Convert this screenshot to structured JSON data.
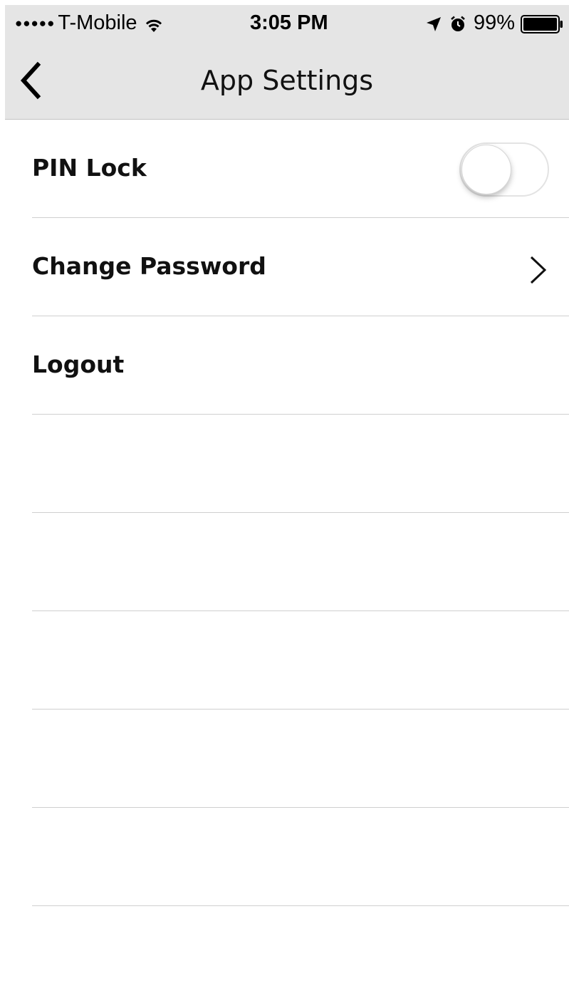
{
  "status_bar": {
    "signal_dots": "●●●●●",
    "carrier": "T-Mobile",
    "time": "3:05 PM",
    "battery_percent": "99%",
    "icons": [
      "wifi-icon",
      "location-arrow-icon",
      "alarm-clock-icon",
      "battery-icon"
    ]
  },
  "nav": {
    "title": "App Settings",
    "back_icon": "chevron-left-icon"
  },
  "settings": {
    "pin_lock": {
      "label": "PIN Lock",
      "enabled": false
    },
    "change_password": {
      "label": "Change Password",
      "icon": "chevron-right-icon"
    },
    "logout": {
      "label": "Logout"
    }
  },
  "colors": {
    "navbar_background": "#e5e5e5",
    "separator": "#cfcfcf",
    "text": "#111111"
  }
}
